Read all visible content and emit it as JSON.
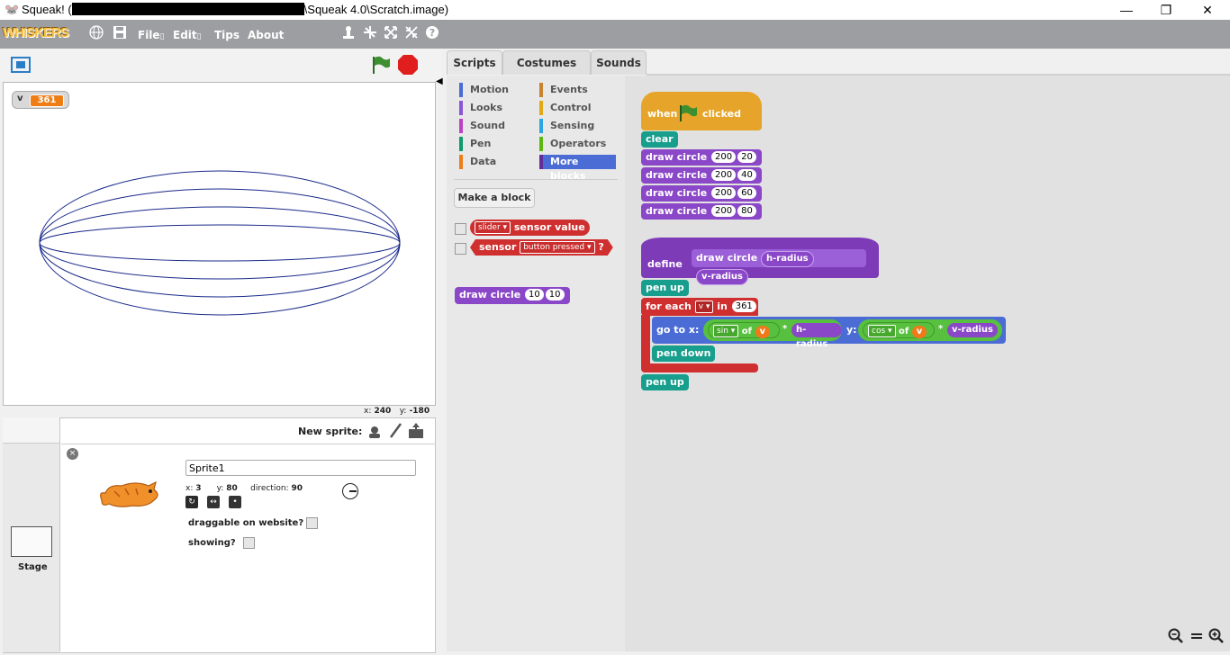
{
  "window": {
    "icon": "squeak-mouse-icon",
    "title_prefix": "Squeak! (",
    "title_suffix": "\\Squeak 4.0\\Scratch.image)",
    "min": "—",
    "restore": "❐",
    "close": "✕"
  },
  "menubar": {
    "logo": "WHISKERS",
    "file": "File",
    "edit": "Edit",
    "tips": "Tips",
    "about": "About"
  },
  "stage": {
    "variable_name": "v",
    "variable_value": "361",
    "mouse_x_label": "x:",
    "mouse_x": "240",
    "mouse_y_label": "y:",
    "mouse_y": "-180"
  },
  "sprite_pane": {
    "new_sprite_label": "New sprite:",
    "stage_label": "Stage",
    "name_value": "Sprite1",
    "x_label": "x:",
    "x": "3",
    "y_label": "y:",
    "y": "80",
    "direction_label": "direction:",
    "direction": "90",
    "draggable_label": "draggable on website?",
    "showing_label": "showing?"
  },
  "tabs": [
    "Scripts",
    "Costumes",
    "Sounds"
  ],
  "categories": {
    "left": [
      "Motion",
      "Looks",
      "Sound",
      "Pen",
      "Data"
    ],
    "right": [
      "Events",
      "Control",
      "Sensing",
      "Operators",
      "More blocks"
    ]
  },
  "colors": {
    "motion": "#4a6cd4",
    "looks": "#8a55d7",
    "sound": "#bb42c3",
    "pen": "#0e9a6c",
    "data": "#ee7d16",
    "events": "#c88330",
    "control": "#e1a91a",
    "sensing": "#2ca5e2",
    "operators": "#5cb712",
    "more": "#632d99"
  },
  "palette": {
    "make_block": "Make a block",
    "slider_dropdown": "slider",
    "sensor_value": "sensor value",
    "sensor_label": "sensor",
    "button_pressed": "button pressed",
    "qmark": "?",
    "draw_circle": "draw circle",
    "dc_a": "10",
    "dc_b": "10"
  },
  "script": {
    "when": "when",
    "clicked": "clicked",
    "clear": "clear",
    "draw_circle": "draw circle",
    "calls": [
      {
        "a": "200",
        "b": "20"
      },
      {
        "a": "200",
        "b": "40"
      },
      {
        "a": "200",
        "b": "60"
      },
      {
        "a": "200",
        "b": "80"
      }
    ],
    "define": "define",
    "h_radius": "h-radius",
    "v_radius": "v-radius",
    "pen_up": "pen up",
    "for_each": "for each",
    "var": "v",
    "in": "in",
    "count": "361",
    "go_to_x": "go to x:",
    "sin": "sin",
    "of": "of",
    "times": "*",
    "y": "y:",
    "cos": "cos",
    "pen_down": "pen down"
  }
}
